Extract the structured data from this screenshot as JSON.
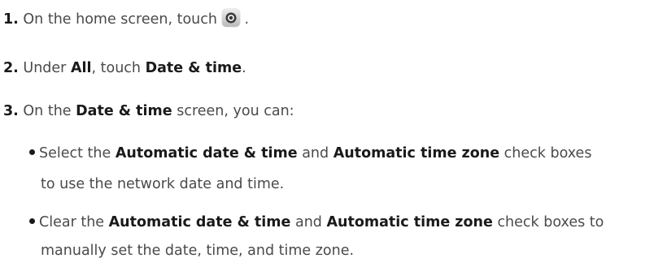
{
  "steps": [
    {
      "number": "1.",
      "text_before": "On the home screen, touch",
      "icon": "settings-gear-icon",
      "text_after": "."
    },
    {
      "number": "2.",
      "prefix": "Under",
      "bold1": "All",
      "middle": ", touch",
      "bold2": "Date & time",
      "suffix": "."
    },
    {
      "number": "3.",
      "prefix": "On the",
      "bold": "Date & time",
      "suffix": "screen, you can:"
    }
  ],
  "bullets": [
    {
      "line1_prefix": "Select the",
      "bold1": "Automatic date & time",
      "and": "and",
      "bold2": "Automatic time zone",
      "line1_suffix": "check boxes",
      "line2": "to use the network date and time."
    },
    {
      "line1_prefix": "Clear the",
      "bold1": "Automatic date & time",
      "and": "and",
      "bold2": "Automatic time zone",
      "line1_suffix": "check boxes to",
      "line2": "manually set the date, time, and time zone."
    }
  ]
}
